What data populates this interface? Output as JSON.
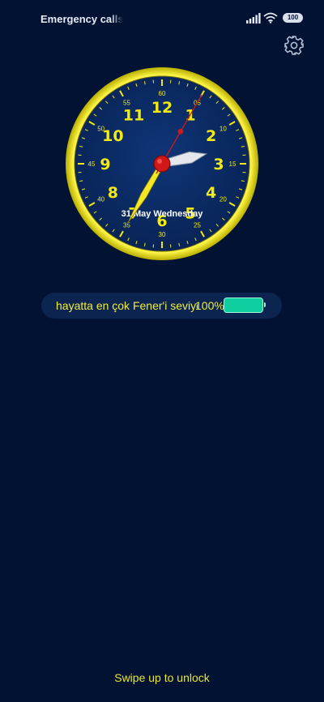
{
  "status_bar": {
    "carrier_text": "Emergency calls only",
    "battery_level": "100",
    "icons": [
      "signal-icon",
      "wifi-icon",
      "battery-icon"
    ]
  },
  "settings": {
    "icon": "gear-icon"
  },
  "clock": {
    "hour_numerals": [
      "12",
      "1",
      "2",
      "3",
      "4",
      "5",
      "6",
      "7",
      "8",
      "9",
      "10",
      "11"
    ],
    "minute_labels": [
      "60",
      "05",
      "10",
      "15",
      "20",
      "25",
      "30",
      "35",
      "40",
      "45",
      "50",
      "55"
    ],
    "date_text": "31 May Wednesday",
    "time": {
      "hour": 2,
      "minute": 35,
      "second": 5
    },
    "colors": {
      "face": "#0a2a63",
      "rim": "#f2ea12",
      "numerals": "#f2ea12",
      "second_hand": "#cc1a1a",
      "hub": "#d01818"
    }
  },
  "battery_pill": {
    "text": "hayatta en çok Fener'i seviyorum",
    "percent": "100%",
    "level": 1.0,
    "accent": "#0fcfa0"
  },
  "unlock": {
    "hint": "Swipe up to unlock"
  }
}
